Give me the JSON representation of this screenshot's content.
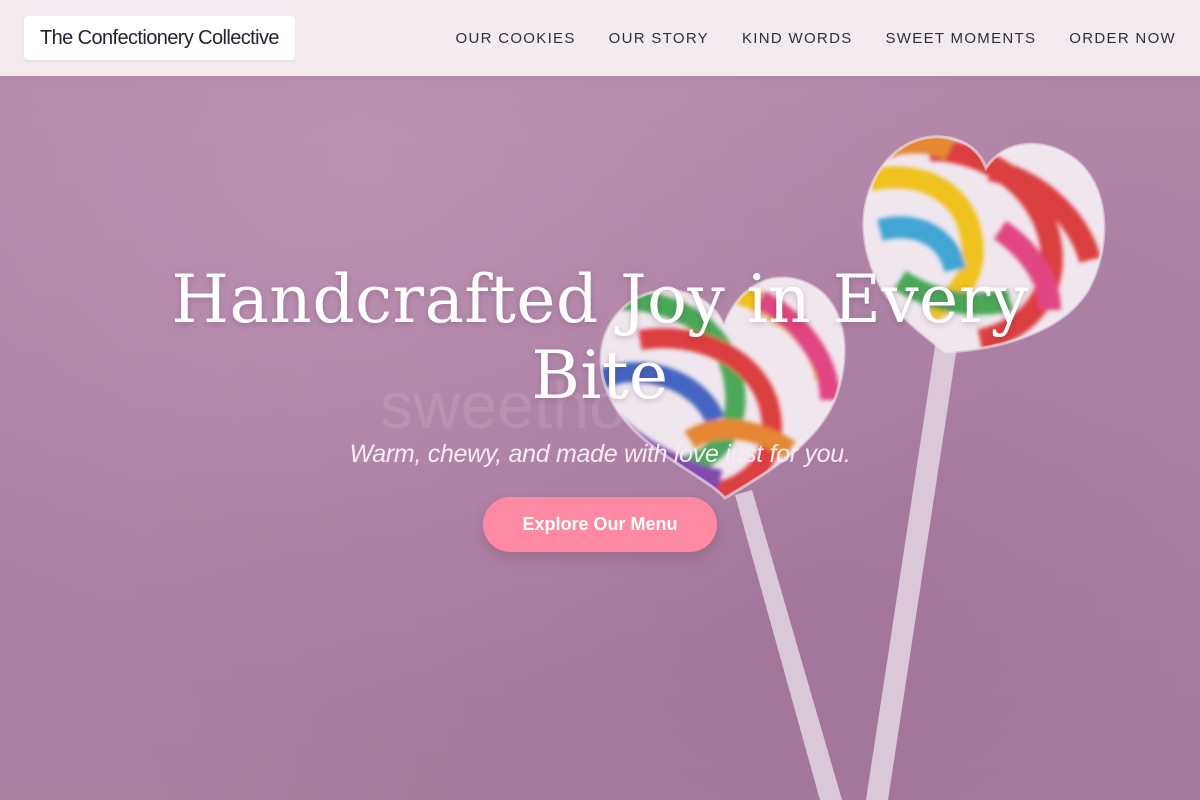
{
  "brand": {
    "name": "The Confectionery Collective"
  },
  "nav": {
    "items": [
      {
        "label": "OUR COOKIES"
      },
      {
        "label": "OUR STORY"
      },
      {
        "label": "KIND WORDS"
      },
      {
        "label": "SWEET MOMENTS"
      },
      {
        "label": "ORDER NOW"
      }
    ]
  },
  "hero": {
    "title": "Handcrafted Joy in Every Bite",
    "subtitle": "Warm, chewy, and made with love just for you.",
    "cta_label": "Explore Our Menu",
    "watermark": "sweethome"
  },
  "colors": {
    "background": "#b084a6",
    "header": "#f6eef3",
    "accent_button": "#fd8aa2",
    "text_dark": "#2c2f40"
  }
}
